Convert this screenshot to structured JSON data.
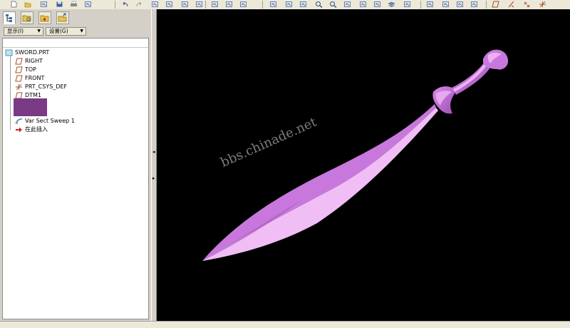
{
  "toolbar": {
    "buttons": [
      "new-file-icon",
      "open-folder-icon",
      "open-from-list-icon",
      "save-icon",
      "print-icon",
      "email-icon",
      "undo-icon",
      "redo-icon",
      "cut-icon",
      "copy-icon",
      "paste-icon",
      "paste-special-icon",
      "regenerate-icon",
      "window-icon",
      "selection-box-icon",
      "sketch-icon",
      "curve-icon",
      "spin-icon",
      "zoom-in-icon",
      "zoom-out-icon",
      "refit-icon",
      "reorient-icon",
      "view-manager-icon",
      "layers-icon",
      "appearance-icon",
      "shading-icon",
      "hidden-line-icon",
      "no-hidden-icon",
      "wireframe-icon",
      "datum-planes-icon",
      "datum-axes-icon",
      "datum-points-icon",
      "csys-icon"
    ]
  },
  "panel_tabs": [
    "model-tree-tab",
    "folder-browser-tab",
    "favorites-tab",
    "history-tab"
  ],
  "panel_menu": {
    "show_label": "显示(I)",
    "settings_label": "设置(G)"
  },
  "model_tree": {
    "root": "SWORD.PRT",
    "items": [
      {
        "label": "RIGHT",
        "icon": "datum-plane-icon"
      },
      {
        "label": "TOP",
        "icon": "datum-plane-icon"
      },
      {
        "label": "FRONT",
        "icon": "datum-plane-icon"
      },
      {
        "label": "PRT_CSYS_DEF",
        "icon": "coordinate-system-icon"
      },
      {
        "label": "DTM1",
        "icon": "datum-plane-icon"
      }
    ],
    "sweep_feature": "Var Sect Sweep 1",
    "insert_here": "在此插入",
    "highlight_color": "#7a3a86"
  },
  "viewport": {
    "background": "#000000",
    "model_color": "#d07ce0",
    "watermark": "bbs.chinade.net"
  }
}
